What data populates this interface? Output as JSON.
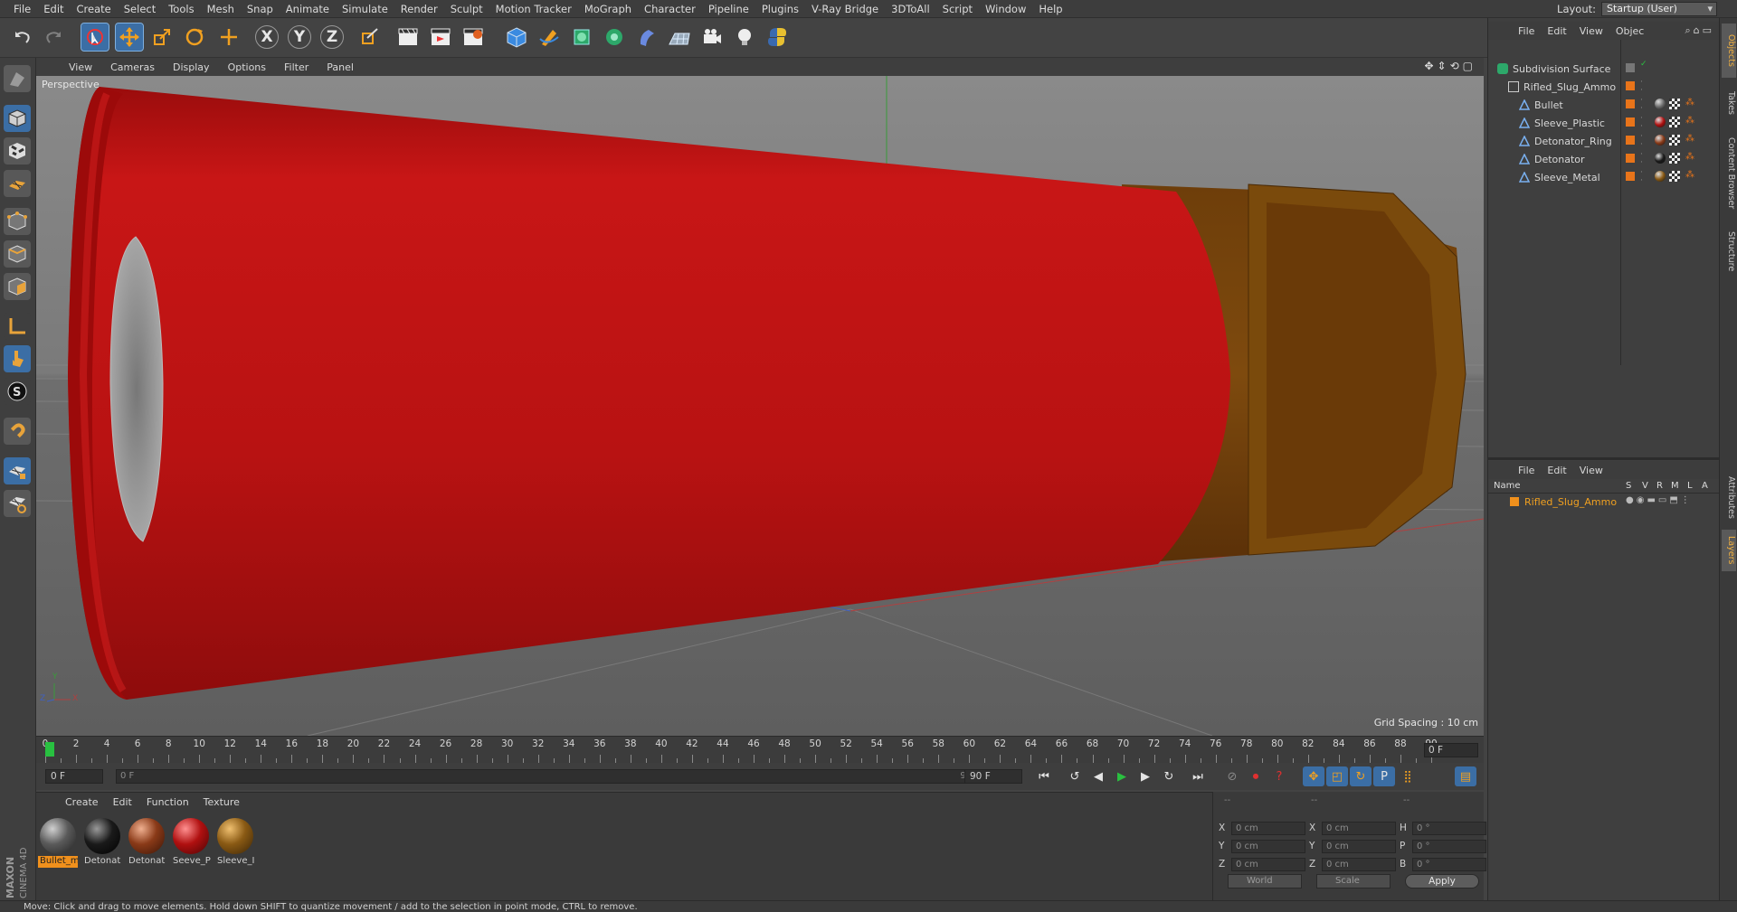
{
  "menubar": {
    "items": [
      "File",
      "Edit",
      "Create",
      "Select",
      "Tools",
      "Mesh",
      "Snap",
      "Animate",
      "Simulate",
      "Render",
      "Sculpt",
      "Motion Tracker",
      "MoGraph",
      "Character",
      "Pipeline",
      "Plugins",
      "V-Ray Bridge",
      "3DToAll",
      "Script",
      "Window",
      "Help"
    ],
    "layout_label": "Layout:",
    "layout_value": "Startup (User)"
  },
  "toolbar": {
    "axis_x": "X",
    "axis_y": "Y",
    "axis_z": "Z"
  },
  "viewport": {
    "menu": [
      "View",
      "Cameras",
      "Display",
      "Options",
      "Filter",
      "Panel"
    ],
    "camera_label": "Perspective",
    "grid_spacing": "Grid Spacing : 10 cm",
    "axis_y": "Y",
    "axis_x": "X",
    "axis_z": "Z"
  },
  "timeline": {
    "ticks": [
      "0",
      "2",
      "4",
      "6",
      "8",
      "10",
      "12",
      "14",
      "16",
      "18",
      "20",
      "22",
      "24",
      "26",
      "28",
      "30",
      "32",
      "34",
      "36",
      "38",
      "40",
      "42",
      "44",
      "46",
      "48",
      "50",
      "52",
      "54",
      "56",
      "58",
      "60",
      "62",
      "64",
      "66",
      "68",
      "70",
      "72",
      "74",
      "76",
      "78",
      "80",
      "82",
      "84",
      "86",
      "88",
      "90"
    ],
    "current_frame": "0 F"
  },
  "transport": {
    "start_frame": "0 F",
    "range_start": "0 F",
    "range_end": "90 F",
    "end_frame": "90 F"
  },
  "materials": {
    "menu": [
      "Create",
      "Edit",
      "Function",
      "Texture"
    ],
    "items": [
      {
        "label": "Bullet_m",
        "color": "#5a5a5a",
        "selected": true
      },
      {
        "label": "Detonat",
        "color": "#1a1a1a",
        "selected": false
      },
      {
        "label": "Detonat",
        "color": "#8a3a18",
        "selected": false
      },
      {
        "label": "Seeve_P",
        "color": "#b01010",
        "selected": false
      },
      {
        "label": "Sleeve_I",
        "color": "#8a5a14",
        "selected": false
      }
    ]
  },
  "coordinates": {
    "header_1": "--",
    "header_2": "--",
    "header_3": "--",
    "rows": [
      {
        "a": "X",
        "av": "0 cm",
        "b": "X",
        "bv": "0 cm",
        "c": "H",
        "cv": "0 °"
      },
      {
        "a": "Y",
        "av": "0 cm",
        "b": "Y",
        "bv": "0 cm",
        "c": "P",
        "cv": "0 °"
      },
      {
        "a": "Z",
        "av": "0 cm",
        "b": "Z",
        "bv": "0 cm",
        "c": "B",
        "cv": "0 °"
      }
    ],
    "world": "World",
    "scale": "Scale",
    "apply": "Apply"
  },
  "objects_panel": {
    "menu": [
      "File",
      "Edit",
      "View",
      "Objec"
    ],
    "items": [
      {
        "name": "Subdivision Surface",
        "level": 0,
        "icon": "subdivision-icon",
        "material": ""
      },
      {
        "name": "Rifled_Slug_Ammo",
        "level": 1,
        "icon": "null-icon",
        "material": ""
      },
      {
        "name": "Bullet",
        "level": 2,
        "icon": "polygon-icon",
        "material": "#6a6a6a"
      },
      {
        "name": "Sleeve_Plastic",
        "level": 2,
        "icon": "polygon-icon",
        "material": "#b01010"
      },
      {
        "name": "Detonator_Ring",
        "level": 2,
        "icon": "polygon-icon",
        "material": "#8a3a18"
      },
      {
        "name": "Detonator",
        "level": 2,
        "icon": "polygon-icon",
        "material": "#1a1a1a"
      },
      {
        "name": "Sleeve_Metal",
        "level": 2,
        "icon": "polygon-icon",
        "material": "#8a5a14"
      }
    ]
  },
  "layers_panel": {
    "menu": [
      "File",
      "Edit",
      "View"
    ],
    "columns": [
      "Name",
      "S",
      "V",
      "R",
      "M",
      "L",
      "A"
    ],
    "layer_name": "Rifled_Slug_Ammo",
    "layer_color": "#f0901c"
  },
  "side_tabs": [
    "Objects",
    "Takes",
    "Content Browser",
    "Structure",
    "Attributes",
    "Layers"
  ],
  "status": "Move: Click and drag to move elements. Hold down SHIFT to quantize movement / add to the selection in point mode, CTRL to remove.",
  "brand": {
    "line1": "MAXON",
    "line2": "CINEMA 4D"
  },
  "colors": {
    "accent": "#f0901c",
    "sleeve_red": "#c81a1a",
    "brass": "#8a5410",
    "selection_blue": "#3b6ea5"
  }
}
